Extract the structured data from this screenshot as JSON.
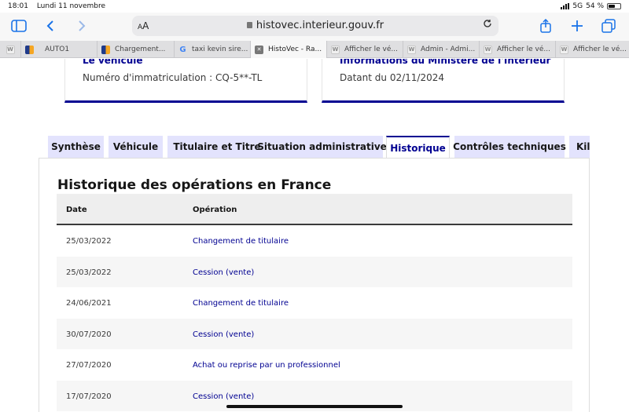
{
  "status_bar": {
    "time": "18:01",
    "date": "Lundi 11 novembre",
    "network": "5G",
    "battery": "54 %"
  },
  "toolbar": {
    "sidebar_icon": "sidebar-icon",
    "back_icon": "chevron-left-icon",
    "forward_icon": "chevron-right-icon",
    "text_size_label": "AA",
    "url": "histovec.interieur.gouv.fr",
    "reload_icon": "reload-icon",
    "share_icon": "share-icon",
    "new_tab_icon": "plus-icon",
    "tabs_icon": "tabs-icon"
  },
  "browser_tabs": [
    {
      "label": "",
      "icon": "w"
    },
    {
      "label": "AUTO1",
      "icon": "flag"
    },
    {
      "label": "Chargement...",
      "icon": "flag"
    },
    {
      "label": "taxi kevin sire...",
      "icon": "g"
    },
    {
      "label": "HistoVec - Ra...",
      "icon": "x",
      "active": true
    },
    {
      "label": "Afficher le vé...",
      "icon": "w"
    },
    {
      "label": "Admin - Admi...",
      "icon": "w"
    },
    {
      "label": "Afficher le vé...",
      "icon": "w"
    },
    {
      "label": "Afficher le vé...",
      "icon": "w"
    }
  ],
  "cards": {
    "left": {
      "title": "Le véhicule",
      "text": "Numéro d'immatriculation : CQ-5**-TL"
    },
    "right": {
      "title": "Informations du Ministère de l'Intérieur",
      "text": "Datant du 02/11/2024"
    }
  },
  "nav_tabs": [
    {
      "label": "Synthèse"
    },
    {
      "label": "Véhicule"
    },
    {
      "label": "Titulaire et Titre"
    },
    {
      "label": "Situation administrative"
    },
    {
      "label": "Historique",
      "active": true
    },
    {
      "label": "Contrôles techniques"
    },
    {
      "label": "Kilo"
    }
  ],
  "history": {
    "title": "Historique des opérations en France",
    "columns": {
      "date": "Date",
      "operation": "Opération"
    },
    "rows": [
      {
        "date": "25/03/2022",
        "operation": "Changement de titulaire"
      },
      {
        "date": "25/03/2022",
        "operation": "Cession (vente)"
      },
      {
        "date": "24/06/2021",
        "operation": "Changement de titulaire"
      },
      {
        "date": "30/07/2020",
        "operation": "Cession (vente)"
      },
      {
        "date": "27/07/2020",
        "operation": "Achat ou reprise par un professionnel"
      },
      {
        "date": "17/07/2020",
        "operation": "Cession (vente)"
      }
    ]
  },
  "colors": {
    "accent": "#000091",
    "tab_bg": "#e3e3fd",
    "ios_blue": "#1a73e8"
  }
}
